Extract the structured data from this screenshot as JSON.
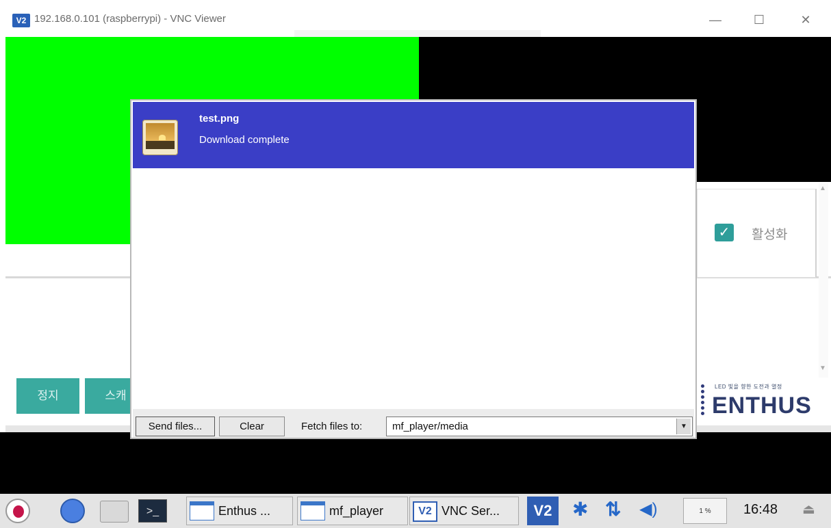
{
  "window": {
    "title": "192.168.0.101 (raspberrypi) - VNC Viewer",
    "logo_text": "V2",
    "minimize": "—",
    "maximize": "☐",
    "close": "✕"
  },
  "remote": {
    "checkbox_label": "활성화",
    "buttons": [
      "정지",
      "스캐"
    ],
    "brand_tagline": "LED 빛을 향한 도전과 열정",
    "brand_name": "ENTHUS",
    "colors": {
      "green": "#00ff00",
      "teal": "#3aaa9f",
      "brand": "#2d3b6b"
    }
  },
  "file_transfer": {
    "file_name": "test.png",
    "status": "Download complete",
    "send_button": "Send files...",
    "clear_button": "Clear",
    "fetch_label": "Fetch files to:",
    "fetch_path": "mf_player/media",
    "header_color": "#3a3ec6"
  },
  "taskbar": {
    "tasks": [
      {
        "label": "Enthus ...",
        "icon": "window-icon"
      },
      {
        "label": "mf_player",
        "icon": "window-icon"
      },
      {
        "label": "VNC Ser...",
        "icon": "vnc-icon"
      }
    ],
    "vnc_tray_text": "V2",
    "cpu_text": "1 %",
    "clock": "16:48"
  }
}
